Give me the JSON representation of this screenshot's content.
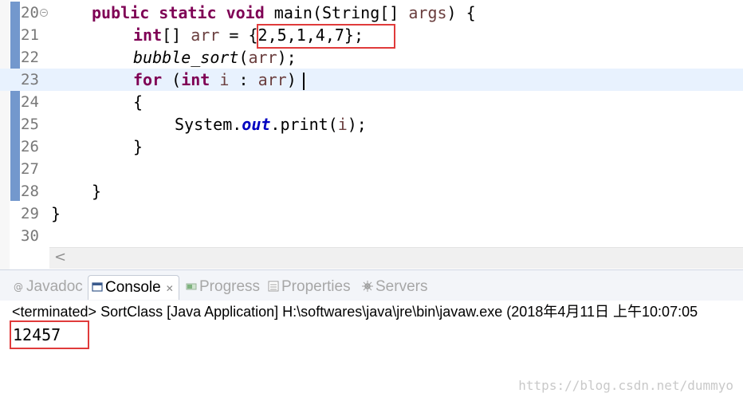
{
  "editor": {
    "lines": [
      {
        "no": "20"
      },
      {
        "no": "21"
      },
      {
        "no": "22"
      },
      {
        "no": "23"
      },
      {
        "no": "24"
      },
      {
        "no": "25"
      },
      {
        "no": "26"
      },
      {
        "no": "27"
      },
      {
        "no": "28"
      },
      {
        "no": "29"
      },
      {
        "no": "30"
      }
    ],
    "code": {
      "l20_kw": "public static void",
      "l20_rest": " main(String[] ",
      "l20_param": "args",
      "l20_end": ") {",
      "l21_kw": "int",
      "l21_mid": "[] ",
      "l21_var": "arr",
      "l21_eq": " = ",
      "l21_init": "{2,5,1,4,7};",
      "l22_call": "bubble_sort",
      "l22_open": "(",
      "l22_var": "arr",
      "l22_end": ");",
      "l23_kw1": "for",
      "l23_open": " (",
      "l23_kw2": "int",
      "l23_i": " i",
      "l23_colon": " : ",
      "l23_var": "arr",
      "l23_end": ")",
      "l24": "{",
      "l25_pre": "System.",
      "l25_out": "out",
      "l25_print": ".print(",
      "l25_var": "i",
      "l25_end": ");",
      "l26": "}",
      "l28": "}",
      "l29": "}"
    },
    "scroll_left_glyph": "<"
  },
  "console": {
    "tabs": [
      {
        "label": "Javadoc",
        "icon": "at-icon"
      },
      {
        "label": "Console",
        "icon": "console-icon"
      },
      {
        "label": "Progress",
        "icon": "progress-icon"
      },
      {
        "label": "Properties",
        "icon": "properties-icon"
      },
      {
        "label": "Servers",
        "icon": "servers-icon"
      }
    ],
    "close_glyph": "✕",
    "status": "<terminated> SortClass [Java Application] H:\\softwares\\java\\jre\\bin\\javaw.exe (2018年4月11日 上午10:07:05",
    "output": "12457"
  },
  "watermark": "https://blog.csdn.net/dummyo",
  "colors": {
    "keyword": "#7f0055",
    "field": "#0000c0",
    "highlight_box": "#e03b3b",
    "current_line": "#e8f2fe"
  }
}
